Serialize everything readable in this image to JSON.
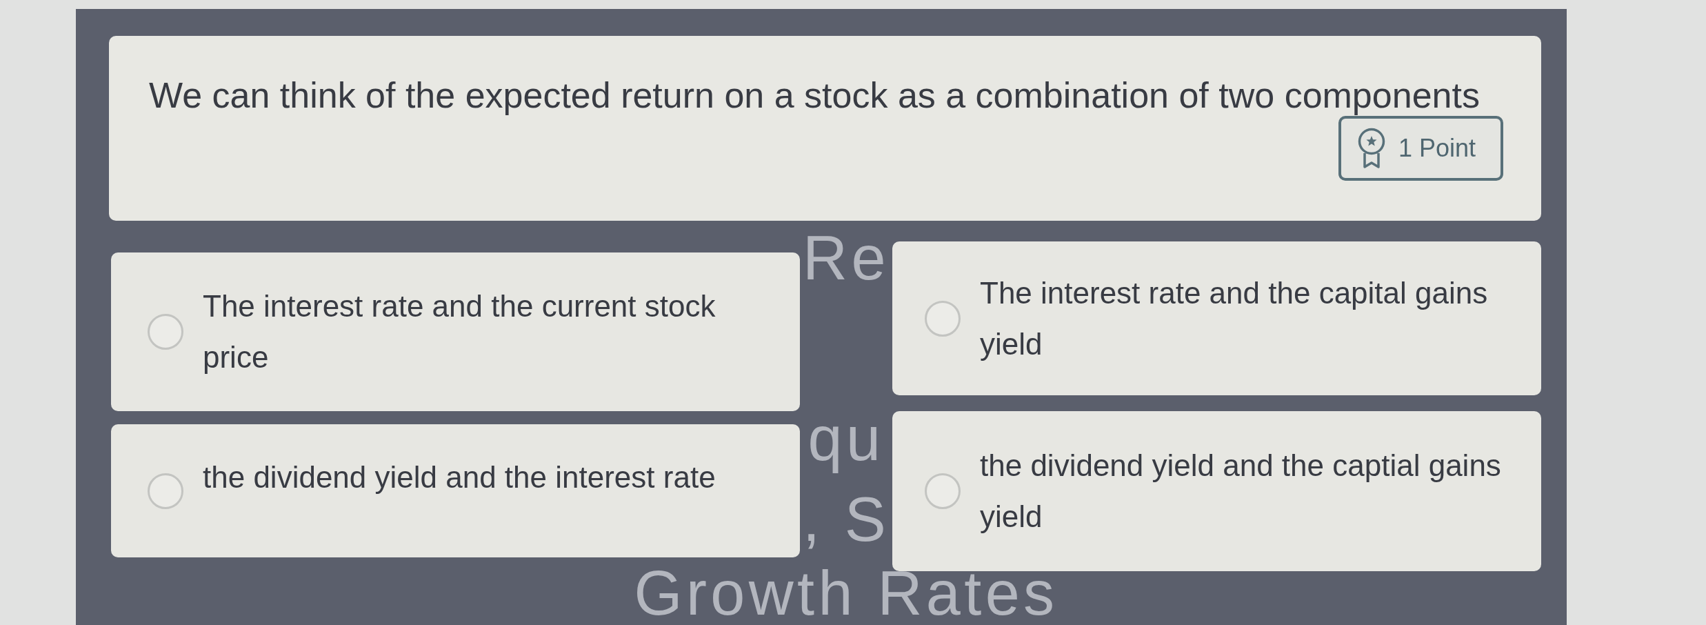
{
  "question": {
    "text": "We can think of the expected return on a stock as a combination of two components",
    "points_badge": "1 Point"
  },
  "options": [
    {
      "text": "The interest rate and the current stock price",
      "selected": false
    },
    {
      "text": "The interest rate and the capital gains yield",
      "selected": false
    },
    {
      "text": "the dividend yield and the interest rate",
      "selected": false
    },
    {
      "text": "the dividend yield and the captial gains yield",
      "selected": false
    }
  ],
  "background_title_fragments": [
    "Re",
    "qu",
    ", S",
    "Growth Rates"
  ]
}
